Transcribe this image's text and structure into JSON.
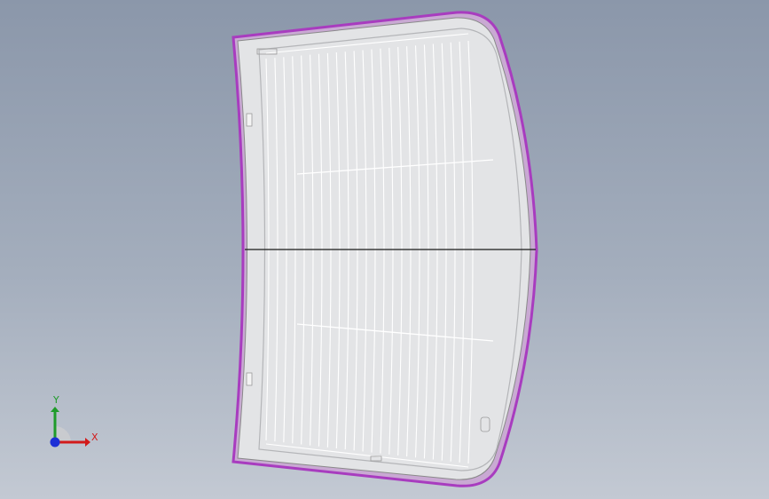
{
  "viewport": {
    "background_top": "#8b97aa",
    "background_bottom": "#c3c9d3",
    "part": {
      "name": "rear-window-glass",
      "fill": "#e3e4e6",
      "edge_color": "#a83cbf",
      "grid_color": "#ffffff",
      "vertical_heater_lines": 24,
      "section_line": "horizontal"
    }
  },
  "triad": {
    "x_label": "X",
    "y_label": "Y",
    "x_color": "#d21a1a",
    "y_color": "#1f9b2a",
    "z_color": "#1c2fd6"
  }
}
